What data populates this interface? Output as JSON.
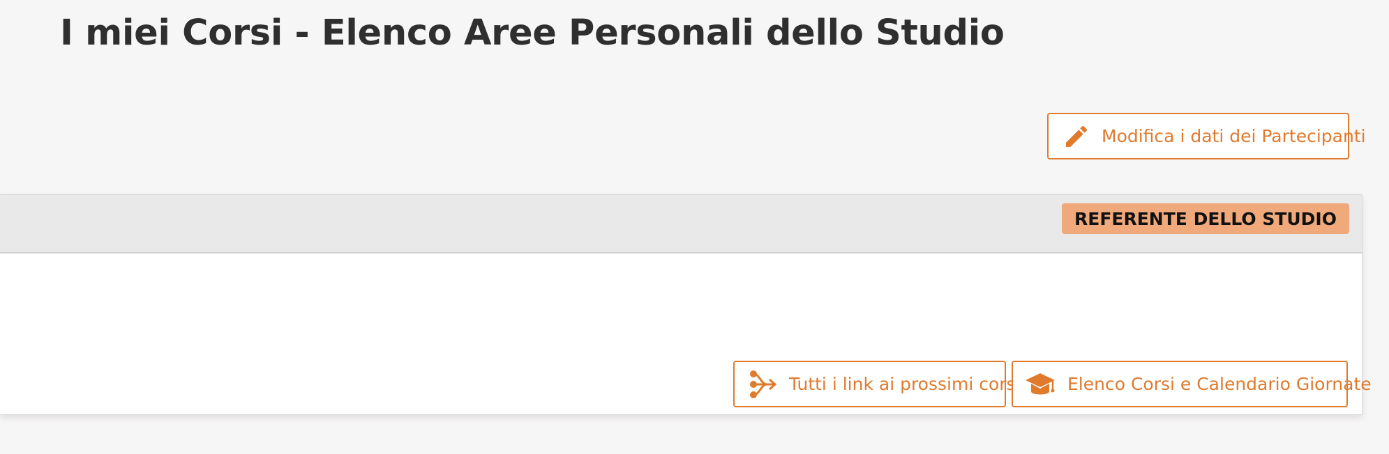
{
  "page": {
    "title": "I miei Corsi - Elenco Aree Personali dello Studio"
  },
  "actions": {
    "edit_participants_label": "Modifica i dati dei Partecipanti",
    "edit_icon": "pencil-icon"
  },
  "card": {
    "role_badge": "REFERENTE DELLO STUDIO",
    "buttons": [
      {
        "label": "Tutti i link ai prossimi corsi",
        "icon": "share-branch-icon"
      },
      {
        "label": "Elenco Corsi e Calendario Giornate",
        "icon": "graduation-cap-icon"
      }
    ]
  },
  "colors": {
    "accent": "#e07a2d",
    "badge_bg": "#f0a97b",
    "page_bg": "#f7f6f6",
    "header_bg": "#e9e9e9"
  }
}
